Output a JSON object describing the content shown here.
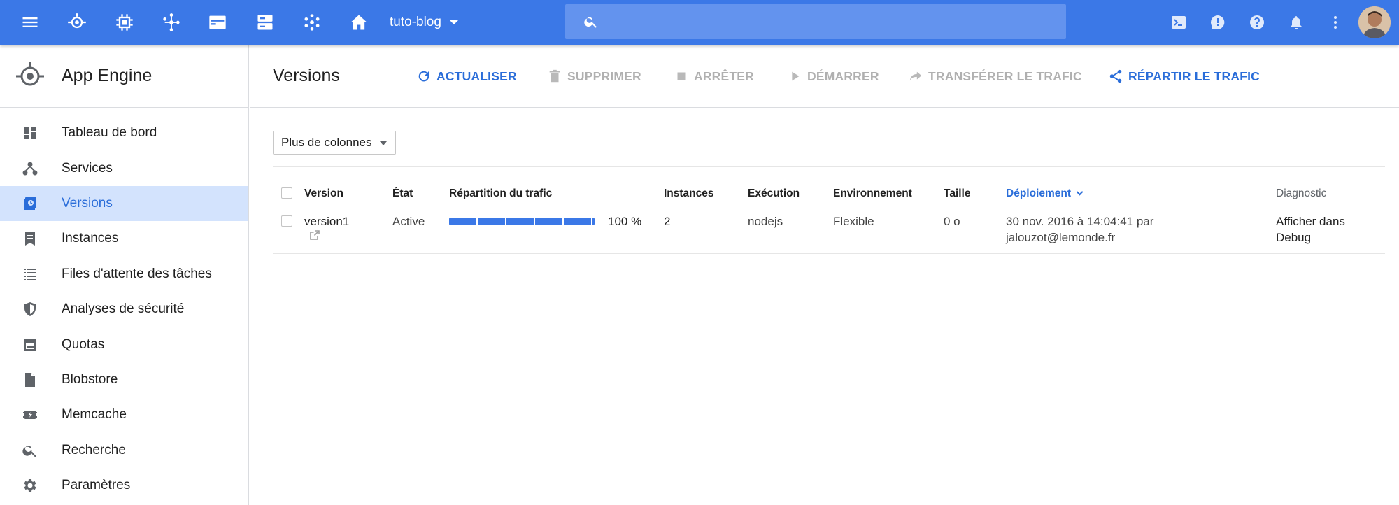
{
  "topbar": {
    "project": "tuto-blog",
    "search_placeholder": ""
  },
  "sidebar": {
    "title": "App Engine",
    "items": [
      {
        "label": "Tableau de bord",
        "icon": "dashboard-icon",
        "active": false
      },
      {
        "label": "Services",
        "icon": "services-icon",
        "active": false
      },
      {
        "label": "Versions",
        "icon": "versions-icon",
        "active": true
      },
      {
        "label": "Instances",
        "icon": "instances-icon",
        "active": false
      },
      {
        "label": "Files d'attente des tâches",
        "icon": "list-icon",
        "active": false
      },
      {
        "label": "Analyses de sécurité",
        "icon": "shield-icon",
        "active": false
      },
      {
        "label": "Quotas",
        "icon": "quotas-icon",
        "active": false
      },
      {
        "label": "Blobstore",
        "icon": "file-icon",
        "active": false
      },
      {
        "label": "Memcache",
        "icon": "memcache-icon",
        "active": false
      },
      {
        "label": "Recherche",
        "icon": "search-icon",
        "active": false
      },
      {
        "label": "Paramètres",
        "icon": "gear-icon",
        "active": false
      }
    ]
  },
  "main": {
    "title": "Versions",
    "actions": {
      "refresh": "ACTUALISER",
      "delete": "SUPPRIMER",
      "stop": "ARRÊTER",
      "start": "DÉMARRER",
      "migrate": "TRANSFÉRER LE TRAFIC",
      "split": "RÉPARTIR LE TRAFIC"
    },
    "more_columns": "Plus de colonnes",
    "table": {
      "headers": {
        "version": "Version",
        "state": "État",
        "traffic": "Répartition du trafic",
        "instances": "Instances",
        "runtime": "Exécution",
        "environment": "Environnement",
        "size": "Taille",
        "deployment": "Déploiement",
        "diagnostic": "Diagnostic"
      },
      "rows": [
        {
          "version": "version1",
          "state": "Active",
          "traffic_percent": 100,
          "traffic_label": "100 %",
          "instances": "2",
          "runtime": "nodejs",
          "environment": "Flexible",
          "size": "0 o",
          "deployment_line1": "30 nov. 2016 à 14:04:41 par",
          "deployment_line2": "jalouzot@lemonde.fr",
          "diagnostic_line1": "Afficher dans",
          "diagnostic_line2": "Debug"
        }
      ]
    }
  },
  "colors": {
    "topbar": "#3b78e7",
    "accent": "#2a6dd9",
    "active_nav_bg": "#d3e3fd",
    "disabled": "#b0b0b0"
  }
}
